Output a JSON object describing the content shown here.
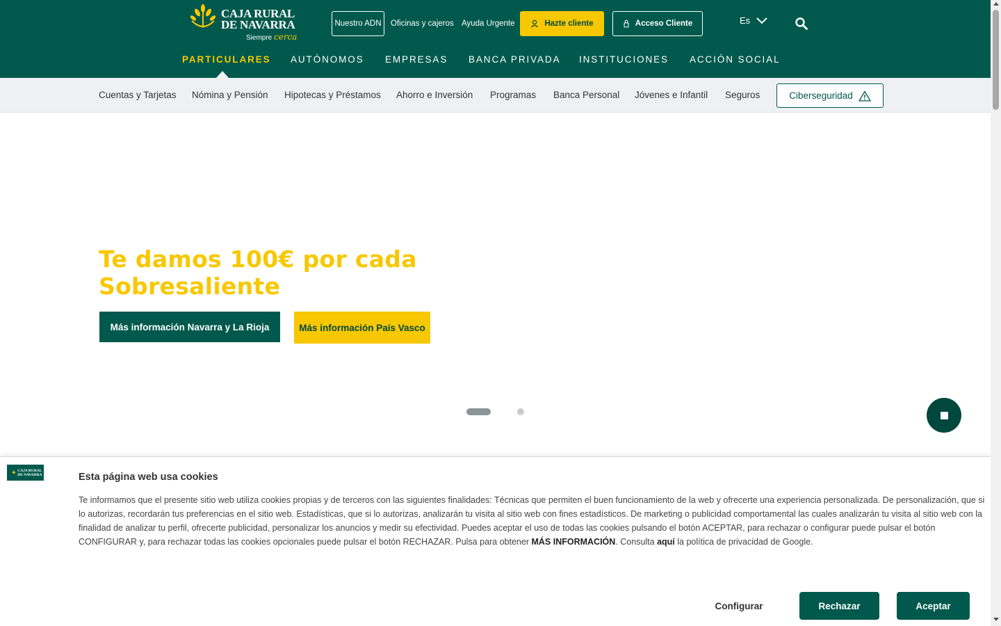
{
  "header": {
    "logo_line1": "CAJA RURAL",
    "logo_line2": "DE NAVARRA",
    "logo_tagline": "Siempre",
    "logo_tagline_accent": "cerca",
    "utility": {
      "adn": "Nuestro ADN",
      "oficinas": "Oficinas y cajeros",
      "ayuda": "Ayuda Urgente",
      "hazte": "Hazte cliente",
      "acceso": "Acceso Cliente",
      "language": "Es"
    },
    "main_nav": [
      {
        "label": "PARTICULARES",
        "active": true
      },
      {
        "label": "AUTÓNOMOS",
        "active": false
      },
      {
        "label": "EMPRESAS",
        "active": false
      },
      {
        "label": "BANCA PRIVADA",
        "active": false
      },
      {
        "label": "INSTITUCIONES",
        "active": false
      },
      {
        "label": "ACCIÓN SOCIAL",
        "active": false
      }
    ]
  },
  "subnav": {
    "items": [
      "Cuentas y Tarjetas",
      "Nómina y Pensión",
      "Hipotecas y Préstamos",
      "Ahorro e Inversión",
      "Programas",
      "Banca Personal",
      "Jóvenes e Infantil",
      "Seguros"
    ],
    "ciberseguridad": "Ciberseguridad"
  },
  "hero": {
    "title_line1": "Te damos 100€ por cada",
    "title_line2": "Sobresaliente",
    "button_navarra": "Más información Navarra y La Rioja",
    "button_pais_vasco": "Más información País Vasco",
    "slides_total": 2,
    "slide_active": 1
  },
  "cookie": {
    "title": "Esta página web usa cookies",
    "text_main": "Te informamos que el presente sitio web utiliza cookies propias y de terceros con las siguientes finalidades: Técnicas que permiten el buen funcionamiento de la web y ofrecerte una experiencia personalizada. De personalización, que si lo autorizas, recordarán tus preferencias en el sitio web. Estadísticas, que si lo autorizas, analizarán tu visita al sitio web con fines estadísticos. De marketing o publicidad comportamental las cuales analizarán tu visita al sitio web con la finalidad de analizar tu perfil, ofrecerte publicidad, personalizar los anuncios y medir su efectividad. Puedes aceptar el uso de todas las cookies pulsando el botón ACEPTAR, para rechazar o configurar puede pulsar el botón CONFIGURAR y, para rechazar todas las cookies opcionales puede pulsar el botón RECHAZAR. Pulsa para obtener ",
    "text_mas_info": "MÁS INFORMACIÓN",
    "text_consulta": ". Consulta ",
    "text_aqui": "aquí",
    "text_end": " la política de privacidad de Google.",
    "configurar": "Configurar",
    "rechazar": "Rechazar",
    "aceptar": "Aceptar"
  },
  "colors": {
    "brand_green": "#00594c",
    "brand_yellow": "#f7c800",
    "subnav_bg": "#eef0f2"
  }
}
